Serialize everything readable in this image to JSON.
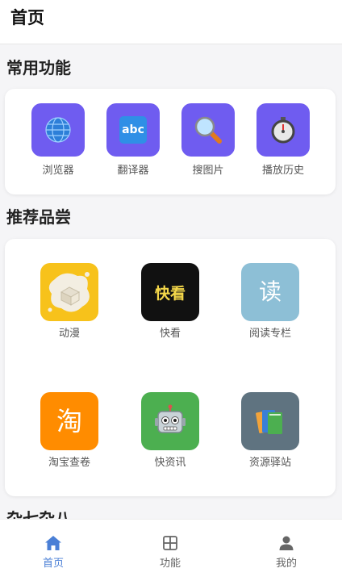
{
  "header": {
    "title": "首页"
  },
  "common": {
    "title": "常用功能",
    "items": [
      {
        "label": "浏览器",
        "icon": "globe-icon"
      },
      {
        "label": "翻译器",
        "icon": "abc-icon",
        "glyph": "abc"
      },
      {
        "label": "搜图片",
        "icon": "magnifier-icon"
      },
      {
        "label": "播放历史",
        "icon": "stopwatch-icon"
      }
    ],
    "accent": "#6f5cf0"
  },
  "recommend": {
    "title": "推荐品尝",
    "items": [
      {
        "label": "动漫",
        "icon": "anime-icon",
        "color": "#f7c21b"
      },
      {
        "label": "快看",
        "icon": "kuaikan-icon",
        "glyph": "快看",
        "color": "#111111"
      },
      {
        "label": "阅读专栏",
        "icon": "read-icon",
        "glyph": "读",
        "color": "#8dbfd6"
      },
      {
        "label": "淘宝查卷",
        "icon": "taobao-icon",
        "glyph": "淘",
        "color": "#ff8c00"
      },
      {
        "label": "快资讯",
        "icon": "robot-icon",
        "color": "#4caf50"
      },
      {
        "label": "资源驿站",
        "icon": "books-icon",
        "color": "#5f7380"
      }
    ]
  },
  "misc": {
    "title": "杂七杂八"
  },
  "tabbar": {
    "items": [
      {
        "label": "首页",
        "icon": "home-icon",
        "active": true
      },
      {
        "label": "功能",
        "icon": "grid-icon",
        "active": false
      },
      {
        "label": "我的",
        "icon": "user-icon",
        "active": false
      }
    ],
    "active_color": "#4a7fd6"
  }
}
